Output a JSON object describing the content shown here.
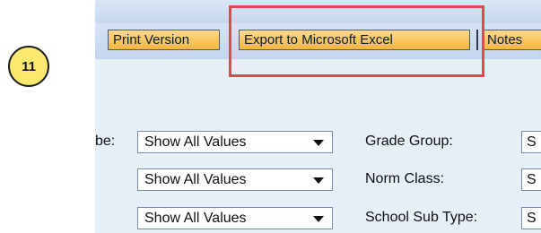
{
  "step_badge": "11",
  "toolbar": {
    "print_label": "Print Version",
    "excel_label": "Export to Microsoft Excel",
    "notes_label": "Notes"
  },
  "filters": {
    "row1": {
      "left_label": "be:",
      "left_value": "Show All Values",
      "right_label": "Grade Group:",
      "right_value": "S"
    },
    "row2": {
      "left_value": "Show All Values",
      "right_label": "Norm Class:",
      "right_value": "S"
    },
    "row3": {
      "left_value": "Show All Values",
      "right_label": "School Sub Type:",
      "right_value": "S"
    }
  },
  "colors": {
    "highlight": "#e34850",
    "button_fill": "#f3b540",
    "panel_bg": "#e6eef8",
    "badge_fill": "#fbe96f"
  }
}
